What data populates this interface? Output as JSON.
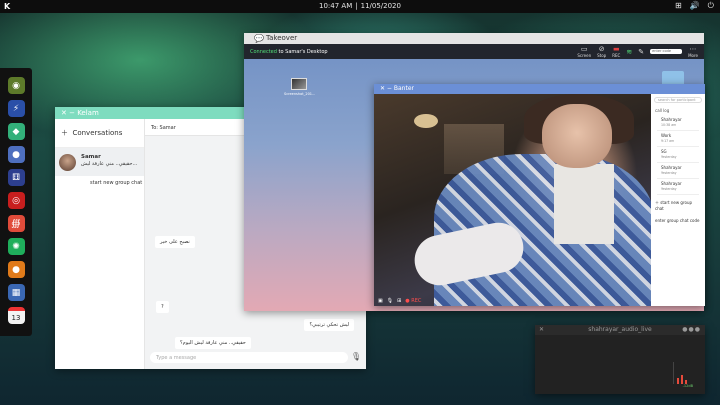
{
  "topbar": {
    "logo": "K",
    "time": "10:47 AM",
    "date": "11/05/2020",
    "tray": {
      "network": "⊞",
      "volume": "🔊",
      "power": "⏻"
    }
  },
  "dock": {
    "items": [
      {
        "name": "dock-app-1",
        "glyph": "◉",
        "color": "#5d7a2a"
      },
      {
        "name": "dock-app-2",
        "glyph": "⚡",
        "color": "#2a4fa8"
      },
      {
        "name": "dock-app-3",
        "glyph": "◆",
        "color": "#33b07a"
      },
      {
        "name": "dock-app-4",
        "glyph": "●",
        "color": "#4e6fbf"
      },
      {
        "name": "dock-app-5",
        "glyph": "⚅",
        "color": "#2d3f8f"
      },
      {
        "name": "dock-app-6",
        "glyph": "◎",
        "color": "#c81e1e"
      },
      {
        "name": "dock-app-7",
        "glyph": "∰",
        "color": "#e04b3a"
      },
      {
        "name": "dock-app-8",
        "glyph": "✺",
        "color": "#1fae5b"
      },
      {
        "name": "dock-app-9",
        "glyph": "●",
        "color": "#e07a1a"
      },
      {
        "name": "dock-app-10",
        "glyph": "▦",
        "color": "#3a67b3"
      },
      {
        "name": "dock-app-calendar",
        "glyph": "13",
        "color": "#f3f3f3"
      }
    ]
  },
  "kelam": {
    "title": "Kelam",
    "conversations_label": "Conversations",
    "contact_name": "Samar",
    "contact_preview": "حقيقي.. مني عارفة ليش...",
    "new_group": "start new group chat",
    "to_label": "To: Samar",
    "messages": [
      {
        "text": "نصبح على خير",
        "side": "in"
      },
      {
        "text": "?",
        "side": "in"
      },
      {
        "text": "ليش تحكي ترتيبي؟",
        "side": "out"
      },
      {
        "text": "حقيقي.. مني عارفة ليش اليوم؟",
        "side": "in"
      }
    ],
    "input_placeholder": "Type a message"
  },
  "takeover": {
    "title": "Takeover",
    "connected_word": "Connected",
    "connected_rest": "to Samar's Desktop",
    "tools": [
      {
        "name": "tool-screen",
        "glyph": "▭",
        "label": "Screen"
      },
      {
        "name": "tool-stop",
        "glyph": "⊘",
        "label": "Stop"
      },
      {
        "name": "tool-rec",
        "glyph": "▬",
        "label": "REC"
      },
      {
        "name": "tool-signal",
        "glyph": "≋",
        "label": ""
      },
      {
        "name": "tool-pen",
        "glyph": "✎",
        "label": ""
      }
    ],
    "code_placeholder": "enter code",
    "more_glyph": "⋯",
    "more_label": "More",
    "desktop_icon_label": "Screenshot_201..."
  },
  "banter": {
    "title": "Banter",
    "search_placeholder": "search for participant",
    "call_log_label": "call log",
    "log": [
      {
        "name": "Shahrayar",
        "time": "10:38 am"
      },
      {
        "name": "Work",
        "time": "9:17 am"
      },
      {
        "name": "SG",
        "time": "Yesterday"
      },
      {
        "name": "Shahrayar",
        "time": "Yesterday"
      },
      {
        "name": "Shahrayar",
        "time": "Yesterday"
      }
    ],
    "new_group": "start new group chat",
    "enter_code": "enter group chat code",
    "controls": {
      "cam": "▣",
      "mic": "🎙",
      "grid": "⊞",
      "rec": "● REC"
    }
  },
  "audio": {
    "title": "shahrayar_audio_live",
    "close": "✕",
    "dots": "●●●",
    "level_label": "-12dB"
  }
}
